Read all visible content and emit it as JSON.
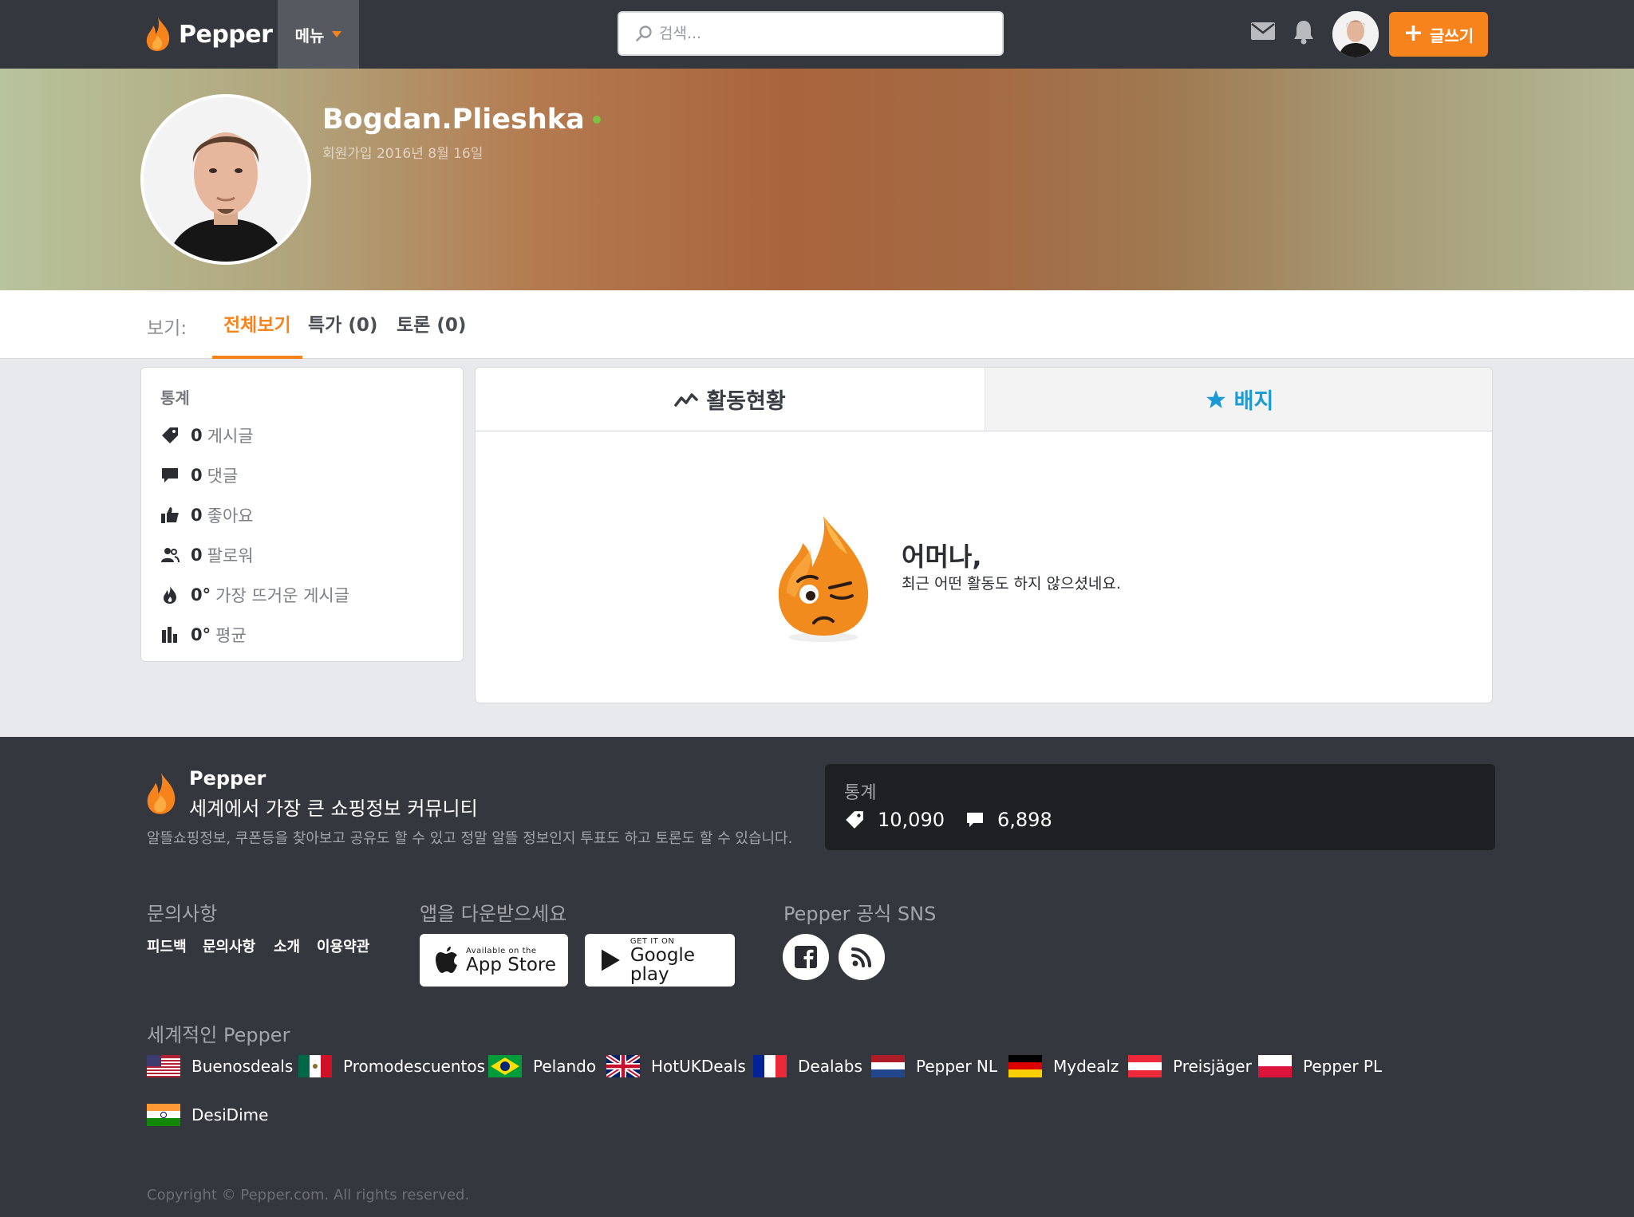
{
  "nav": {
    "logo_text": "Pepper",
    "menu_label": "메뉴",
    "search_placeholder": "검색...",
    "post_button_label": "글쓰기"
  },
  "profile": {
    "username": "Bogdan.Plieshka",
    "joined_text": "회원가입 2016년 8월 16일",
    "online": true
  },
  "tabs": {
    "label": "보기:",
    "items": [
      {
        "label": "전체보기",
        "active": true
      },
      {
        "label": "특가 (0)",
        "active": false
      },
      {
        "label": "토론 (0)",
        "active": false
      }
    ]
  },
  "stats": {
    "title": "통계",
    "rows": [
      {
        "icon": "tag-icon",
        "value": "0",
        "label": "게시글"
      },
      {
        "icon": "comment-icon",
        "value": "0",
        "label": "댓글"
      },
      {
        "icon": "thumbs-up-icon",
        "value": "0",
        "label": "좋아요"
      },
      {
        "icon": "followers-icon",
        "value": "0",
        "label": "팔로워"
      },
      {
        "icon": "flame-icon",
        "value": "0°",
        "label": "가장 뜨거운 게시글"
      },
      {
        "icon": "bar-chart-icon",
        "value": "0°",
        "label": "평균"
      }
    ]
  },
  "activity": {
    "tabs": [
      {
        "label": "활동현황",
        "icon": "activity-icon"
      },
      {
        "label": "배지",
        "icon": "star-icon"
      }
    ],
    "empty_title": "어머나,",
    "empty_message": "최근 어떤 활동도 하지 않으셨네요."
  },
  "footer": {
    "brand": "Pepper",
    "tagline": "세계에서 가장 큰 쇼핑정보 커뮤니티",
    "description": "알뜰쇼핑정보, 쿠폰등을 찾아보고 공유도 할 수 있고 정말 알뜰 정보인지 투표도 하고 토론도 할 수 있습니다.",
    "stats_title": "통계",
    "stat_deals": "10,090",
    "stat_comments": "6,898",
    "contact_heading": "문의사항",
    "contact_links": [
      "피드백",
      "문의사항",
      "소개",
      "이용약관"
    ],
    "app_heading": "앱을 다운받으세요",
    "app_store_small": "Available on the",
    "app_store_big": "App Store",
    "google_small": "GET IT ON",
    "google_big": "Google play",
    "sns_heading": "Pepper 공식 SNS",
    "world_heading": "세계적인 Pepper",
    "countries": [
      "Buenosdeals",
      "Promodescuentos",
      "Pelando",
      "HotUKDeals",
      "Dealabs",
      "Pepper NL",
      "Mydealz",
      "Preisjäger",
      "Pepper PL",
      "DesiDime"
    ],
    "copyright": "Copyright © Pepper.com. All rights reserved."
  },
  "colors": {
    "accent": "#f7831d",
    "nav_bg": "#35373e",
    "badge_tab": "#1a9ad6",
    "online": "#7cc244"
  }
}
